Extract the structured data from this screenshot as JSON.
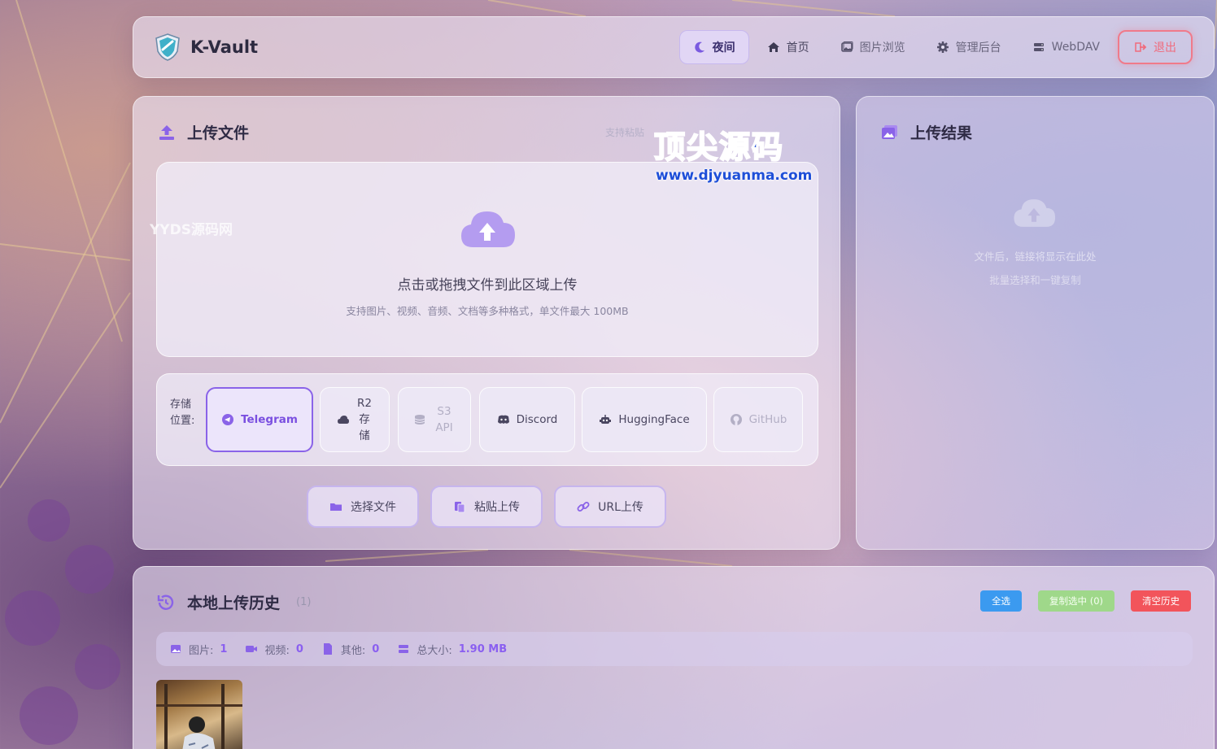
{
  "app": {
    "title": "K-Vault"
  },
  "nav": {
    "items": [
      {
        "label": "夜间",
        "icon": "moon-icon"
      },
      {
        "label": "首页",
        "icon": "home-icon"
      },
      {
        "label": "图片浏览",
        "icon": "image-icon"
      },
      {
        "label": "管理后台",
        "icon": "gear-icon"
      },
      {
        "label": "WebDAV",
        "icon": "server-icon"
      },
      {
        "label": "退出",
        "icon": "logout-icon"
      }
    ]
  },
  "upload": {
    "title": "上传文件",
    "hint": "支持粘贴",
    "drop_title": "点击或拖拽文件到此区域上传",
    "drop_sub": "支持图片、视频、音频、文档等多种格式，单文件最大 100MB",
    "storage_label": "存储位置:",
    "storage_options": [
      {
        "label": "Telegram",
        "icon": "telegram-icon",
        "active": true
      },
      {
        "label": "R2存储",
        "icon": "cloud-icon",
        "active": false
      },
      {
        "label": "S3 API",
        "icon": "database-icon",
        "active": false
      },
      {
        "label": "Discord",
        "icon": "discord-icon",
        "active": false
      },
      {
        "label": "HuggingFace",
        "icon": "robot-icon",
        "active": false
      },
      {
        "label": "GitHub",
        "icon": "github-icon",
        "active": false
      }
    ],
    "actions": [
      {
        "label": "选择文件",
        "icon": "folder-icon"
      },
      {
        "label": "粘贴上传",
        "icon": "paste-icon"
      },
      {
        "label": "URL上传",
        "icon": "link-icon"
      }
    ]
  },
  "result": {
    "title": "上传结果",
    "empty_line1": "文件后，链接将显示在此处",
    "empty_line2": "批量选择和一键复制"
  },
  "history": {
    "title": "本地上传历史",
    "count": "(1)",
    "buttons": {
      "select_all": "全选",
      "copy_selected": "复制选中 (0)",
      "clear": "清空历史"
    },
    "stats": {
      "images_label": "图片:",
      "images": "1",
      "videos_label": "视频:",
      "videos": "0",
      "others_label": "其他:",
      "others": "0",
      "size_label": "总大小:",
      "size": "1.90 MB"
    }
  },
  "watermarks": {
    "site": "www.djyuanma.com",
    "brand": "顶尖源码",
    "yyds": "YYDS源码网"
  },
  "colors": {
    "accent": "#8a63e8",
    "danger": "#f06b7c",
    "blue": "#3b9af0",
    "green": "#9fd88a",
    "red": "#f2545b"
  }
}
